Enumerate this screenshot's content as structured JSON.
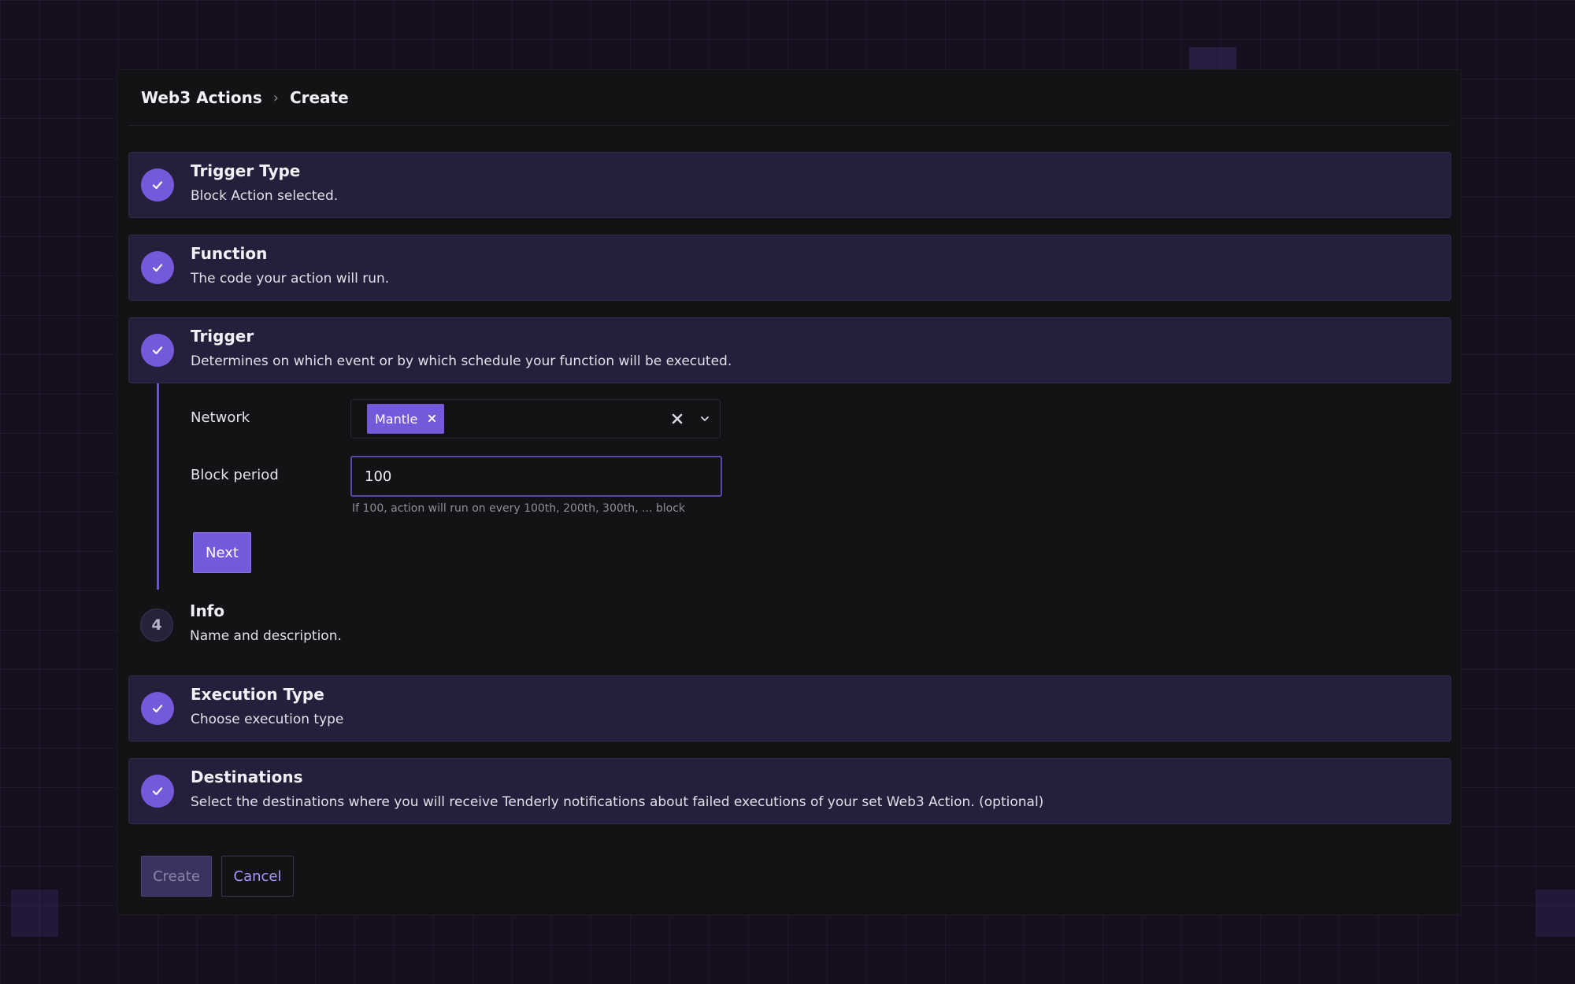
{
  "breadcrumb": {
    "root": "Web3 Actions",
    "current": "Create"
  },
  "steps": [
    {
      "title": "Trigger Type",
      "description": "Block Action selected.",
      "status": "complete"
    },
    {
      "title": "Function",
      "description": "The code your action will run.",
      "status": "complete"
    },
    {
      "title": "Trigger",
      "description": "Determines on which event or by which schedule your function will be executed.",
      "status": "active"
    },
    {
      "number": "4",
      "title": "Info",
      "description": "Name and description.",
      "status": "pending"
    },
    {
      "title": "Execution Type",
      "description": "Choose execution type",
      "status": "complete"
    },
    {
      "title": "Destinations",
      "description": "Select the destinations where you will receive Tenderly notifications about failed executions of your set Web3 Action. (optional)",
      "status": "complete"
    }
  ],
  "trigger_form": {
    "network_label": "Network",
    "network_selected": "Mantle",
    "block_period_label": "Block period",
    "block_period_value": "100",
    "block_period_hint": "If 100, action will run on every 100th, 200th, 300th, ... block",
    "next_label": "Next"
  },
  "actions": {
    "create_label": "Create",
    "cancel_label": "Cancel"
  },
  "icons": {
    "complete": "check-icon",
    "chip_remove": "close-icon",
    "clear": "clear-icon",
    "dropdown": "chevron-down-icon",
    "breadcrumb_separator": "chevron-right-icon"
  },
  "colors": {
    "accent": "#7559db",
    "card_bg": "#24203b",
    "panel_bg": "#131215",
    "page_bg": "#150f20",
    "link": "#a996ff"
  }
}
